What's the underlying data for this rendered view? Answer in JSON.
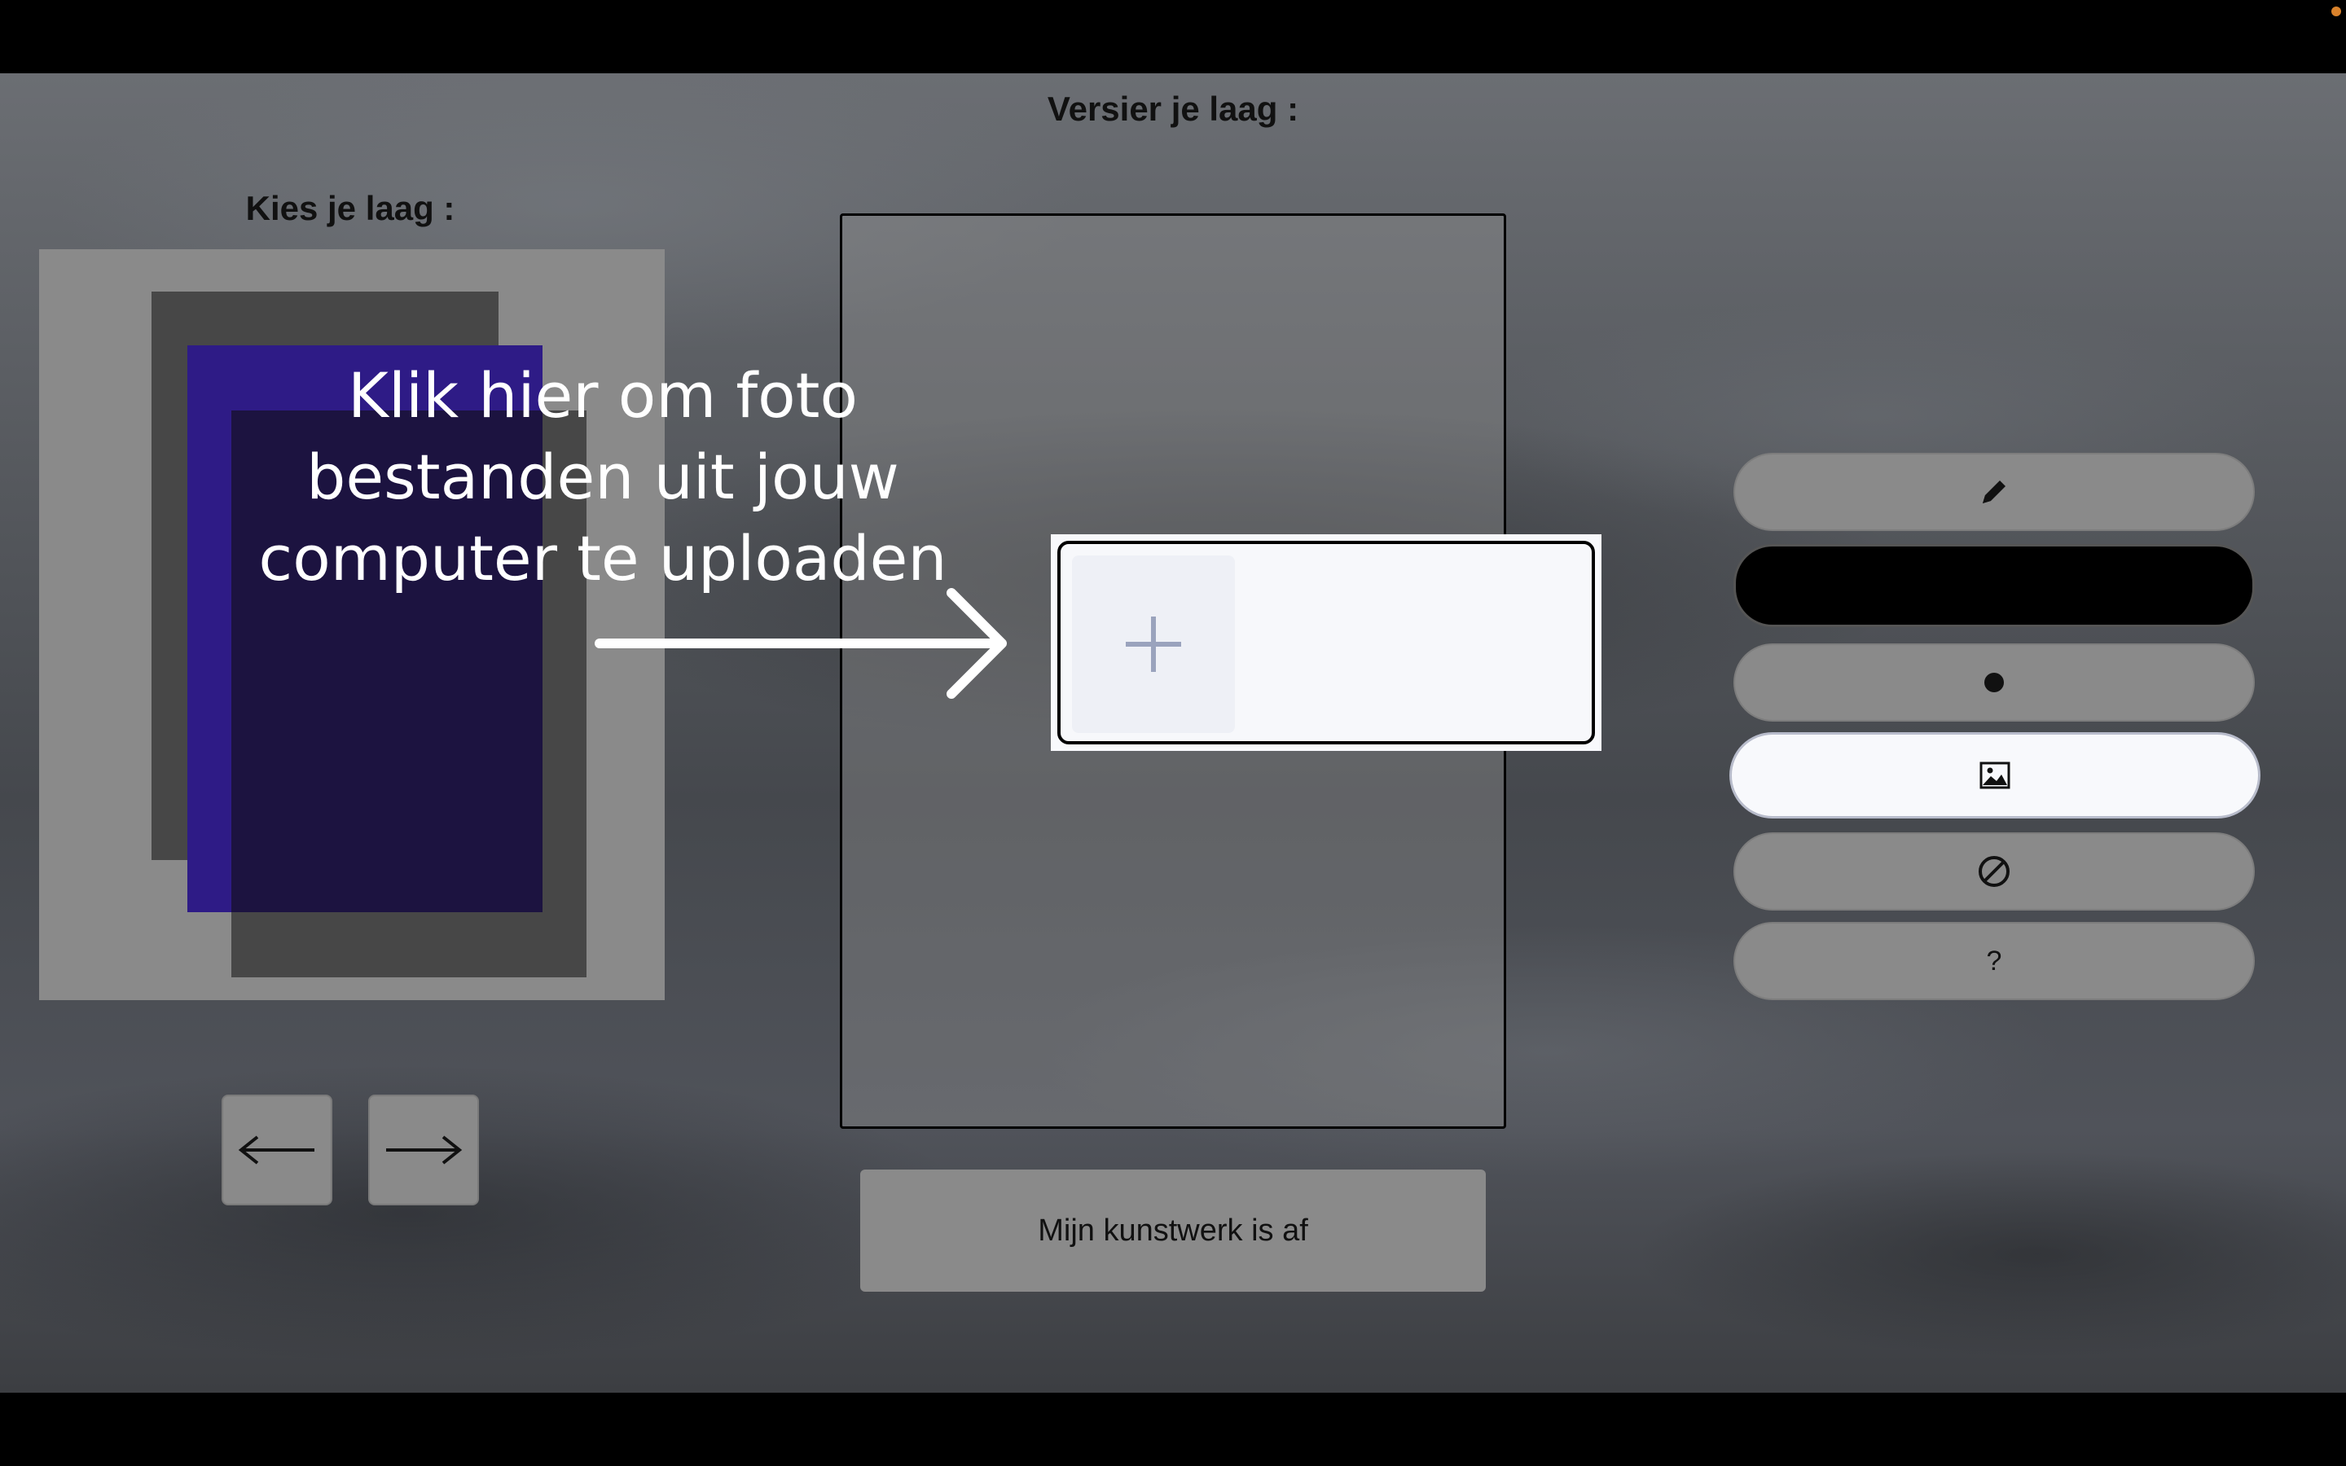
{
  "labels": {
    "choose_layer": "Kies je laag :",
    "decorate_layer": "Versier je laag :"
  },
  "navigation": {
    "prev_icon": "arrow-left-icon",
    "next_icon": "arrow-right-icon"
  },
  "done_button": "Mijn kunstwerk is af",
  "upload_hint": {
    "line1": "Klik hier om foto",
    "line2": "bestanden uit jouw",
    "line3": "computer te uploaden"
  },
  "tools": {
    "pencil_icon": "pencil-icon",
    "color_value": "#000000",
    "brush_icon": "dot-icon",
    "image_icon": "image-icon",
    "eraser_icon": "prohibited-icon",
    "help_label": "?"
  },
  "colors": {
    "layer_purple": "#2e1b86",
    "layer_gray": "#474747",
    "panel_gray": "#8a8a8a",
    "active_tool": "#f8f9fc"
  }
}
